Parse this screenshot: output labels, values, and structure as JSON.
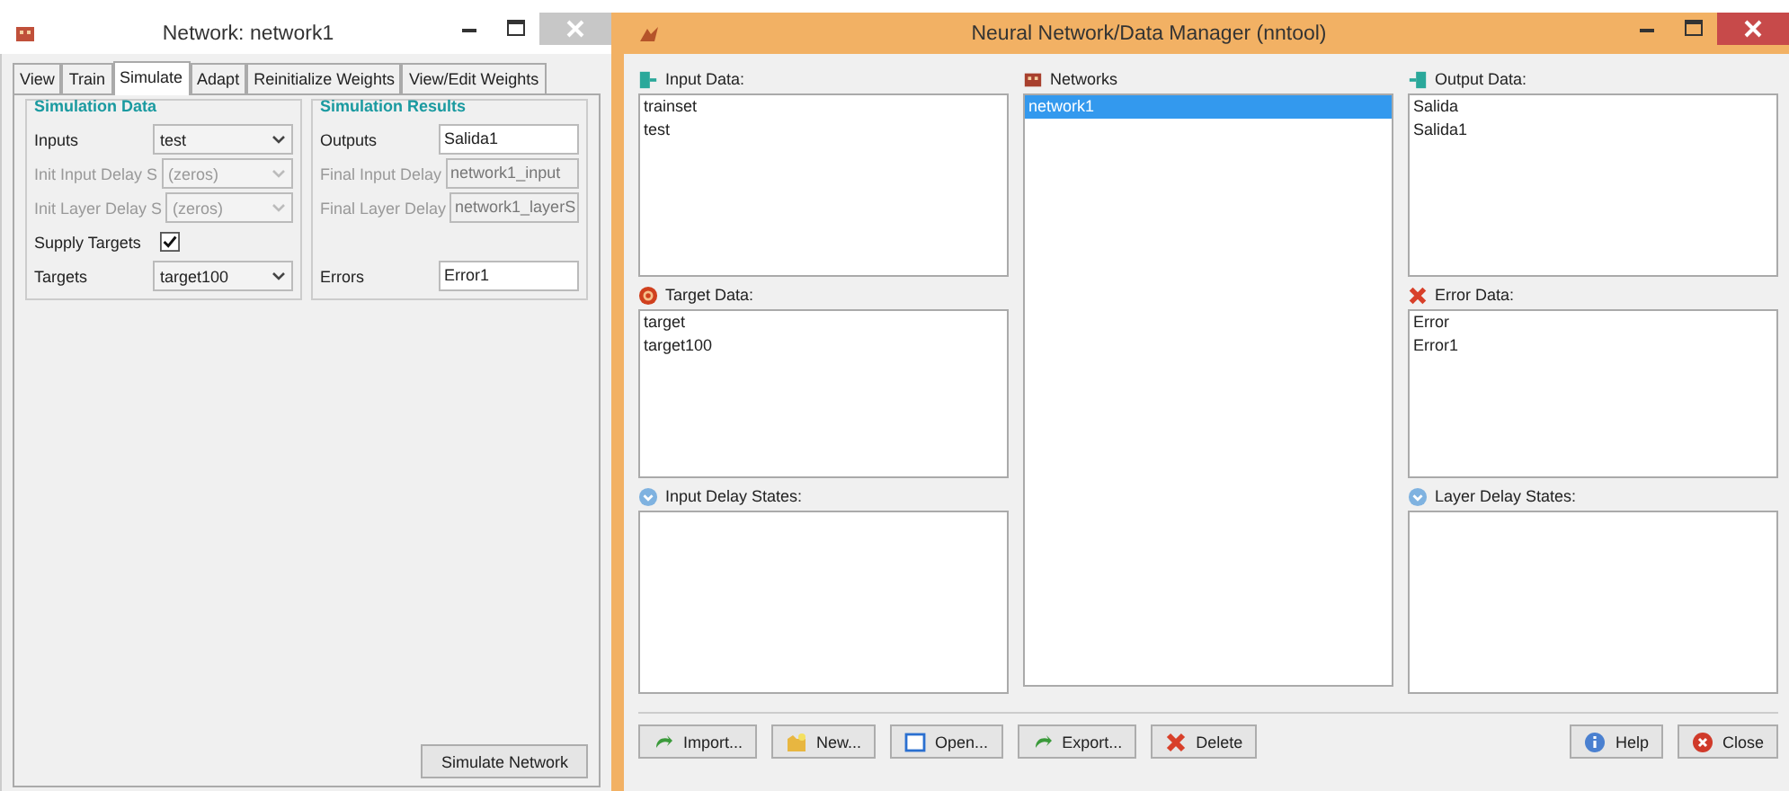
{
  "network_window": {
    "title": "Network: network1",
    "tabs": [
      {
        "label": "View",
        "selected": false
      },
      {
        "label": "Train",
        "selected": false
      },
      {
        "label": "Simulate",
        "selected": true
      },
      {
        "label": "Adapt",
        "selected": false
      },
      {
        "label": "Reinitialize Weights",
        "selected": false
      },
      {
        "label": "View/Edit Weights",
        "selected": false
      }
    ],
    "simulation_data": {
      "title": "Simulation Data",
      "rows": [
        {
          "kind": "select",
          "label": "Inputs",
          "value": "test",
          "disabled": false
        },
        {
          "kind": "select",
          "label": "Init Input Delay S",
          "value": "(zeros)",
          "disabled": true
        },
        {
          "kind": "select",
          "label": "Init Layer Delay S",
          "value": "(zeros)",
          "disabled": true
        },
        {
          "kind": "checkbox",
          "label": "Supply Targets",
          "checked": true
        },
        {
          "kind": "select",
          "label": "Targets",
          "value": "target100",
          "disabled": false
        }
      ]
    },
    "simulation_results": {
      "title": "Simulation Results",
      "rows": [
        {
          "kind": "field",
          "label": "Outputs",
          "value": "Salida1",
          "disabled": false
        },
        {
          "kind": "field",
          "label": "Final Input Delay",
          "value": "network1_input",
          "disabled": true
        },
        {
          "kind": "field",
          "label": "Final Layer Delay",
          "value": "network1_layerS",
          "disabled": true
        },
        {
          "kind": "spacer"
        },
        {
          "kind": "field",
          "label": "Errors",
          "value": "Error1",
          "disabled": false
        }
      ]
    },
    "button": "Simulate Network"
  },
  "manager_window": {
    "title": "Neural Network/Data Manager (nntool)",
    "columns": [
      {
        "lists": [
          {
            "label": "Input Data:",
            "items": [
              {
                "text": "trainset",
                "selected": false
              },
              {
                "text": "test",
                "selected": false
              }
            ]
          },
          {
            "label": "Target Data:",
            "items": [
              {
                "text": "target",
                "selected": false
              },
              {
                "text": "target100",
                "selected": false
              }
            ]
          },
          {
            "label": "Input Delay States:"
          }
        ]
      },
      {
        "lists": [
          {
            "label": "Networks",
            "items": [
              {
                "text": "network1",
                "selected": true
              }
            ]
          }
        ]
      },
      {
        "lists": [
          {
            "label": "Output Data:",
            "items": [
              {
                "text": "Salida",
                "selected": false
              },
              {
                "text": "Salida1",
                "selected": false
              }
            ]
          },
          {
            "label": "Error Data:",
            "items": [
              {
                "text": "Error",
                "selected": false
              },
              {
                "text": "Error1",
                "selected": false
              }
            ]
          },
          {
            "label": "Layer Delay States:"
          }
        ]
      }
    ],
    "buttons_left": [
      "Import...",
      "New...",
      "Open...",
      "Export...",
      "Delete"
    ],
    "buttons_right": [
      "Help",
      "Close"
    ]
  }
}
